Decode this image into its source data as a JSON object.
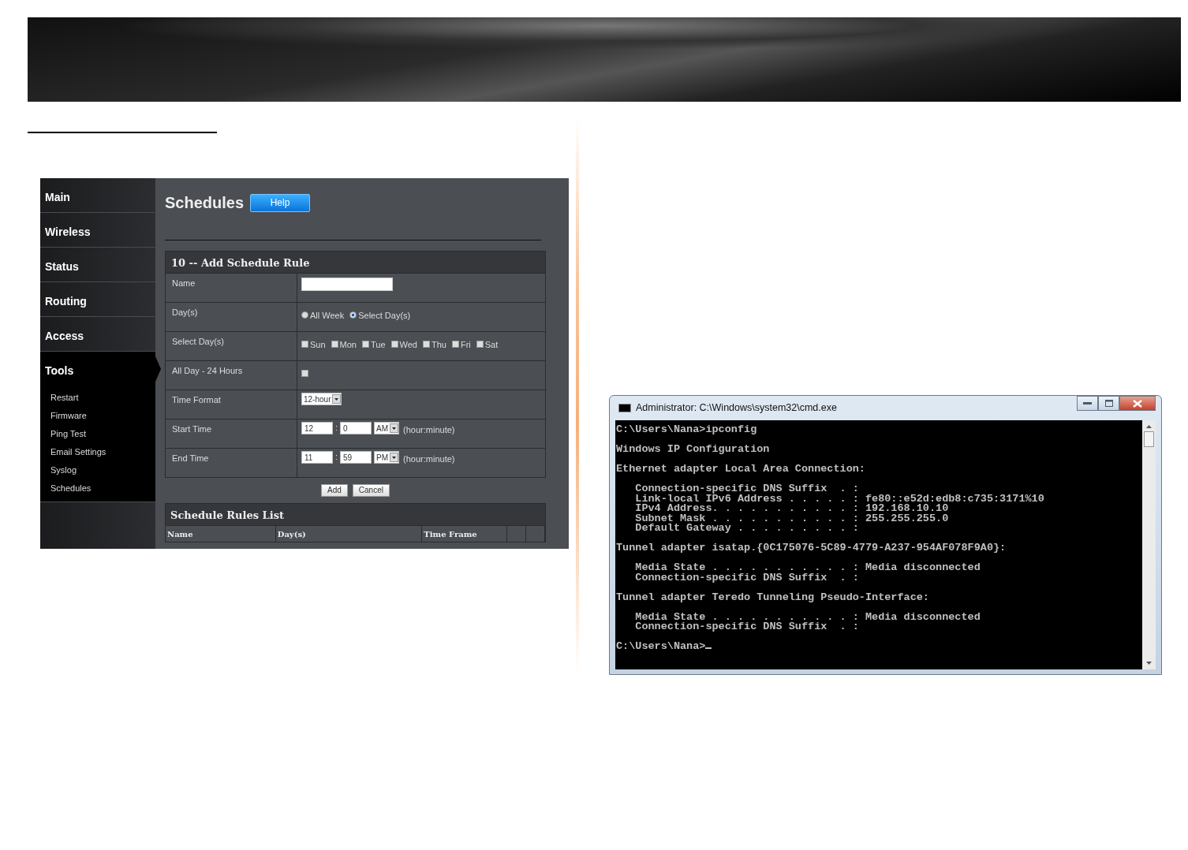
{
  "router_screenshot": {
    "sidebar": {
      "items": [
        {
          "label": "Main",
          "selected": false
        },
        {
          "label": "Wireless",
          "selected": false
        },
        {
          "label": "Status",
          "selected": false
        },
        {
          "label": "Routing",
          "selected": false
        },
        {
          "label": "Access",
          "selected": false
        },
        {
          "label": "Tools",
          "selected": true,
          "children": [
            {
              "label": "Restart"
            },
            {
              "label": "Firmware"
            },
            {
              "label": "Ping Test"
            },
            {
              "label": "Email Settings"
            },
            {
              "label": "Syslog"
            },
            {
              "label": "Schedules"
            }
          ]
        }
      ]
    },
    "page_title": "Schedules",
    "help_button": "Help",
    "form": {
      "title": "10 -- Add Schedule Rule",
      "rows": [
        {
          "kind": "text",
          "label": "Name"
        },
        {
          "kind": "radio",
          "label": "Day(s)",
          "options": [
            {
              "label": "All Week",
              "selected": false
            },
            {
              "label": "Select Day(s)",
              "selected": true
            }
          ]
        },
        {
          "kind": "checkboxes",
          "label": "Select Day(s)",
          "options": [
            {
              "label": "Sun",
              "checked": false
            },
            {
              "label": "Mon",
              "checked": false
            },
            {
              "label": "Tue",
              "checked": false
            },
            {
              "label": "Wed",
              "checked": false
            },
            {
              "label": "Thu",
              "checked": false
            },
            {
              "label": "Fri",
              "checked": false
            },
            {
              "label": "Sat",
              "checked": false
            }
          ]
        },
        {
          "kind": "checkbox",
          "label": "All Day - 24 Hours",
          "checked": false
        },
        {
          "kind": "select",
          "label": "Time Format",
          "value": "12-hour"
        },
        {
          "kind": "time",
          "label": "Start Time",
          "hour": "12",
          "separator": ":",
          "minute": "0",
          "ampm": "AM",
          "hint": "(hour:minute)"
        },
        {
          "kind": "time",
          "label": "End Time",
          "hour": "11",
          "separator": ":",
          "minute": "59",
          "ampm": "PM",
          "hint": "(hour:minute)"
        }
      ],
      "buttons": [
        "Add",
        "Cancel"
      ]
    },
    "rules_list": {
      "title": "Schedule Rules List",
      "columns": [
        "Name",
        "Day(s)",
        "Time Frame"
      ]
    }
  },
  "cmd_window": {
    "title": "Administrator: C:\\Windows\\system32\\cmd.exe",
    "blocks": [
      {
        "lines": [
          "C:\\Users\\Nana>ipconfig"
        ]
      },
      {
        "lines": [
          "Windows IP Configuration"
        ]
      },
      {
        "lines": [
          "Ethernet adapter Local Area Connection:"
        ]
      },
      {
        "lines": [
          "   Connection-specific DNS Suffix  . :",
          "   Link-local IPv6 Address . . . . . : fe80::e52d:edb8:c735:3171%10",
          "   IPv4 Address. . . . . . . . . . . : 192.168.10.10",
          "   Subnet Mask . . . . . . . . . . . : 255.255.255.0",
          "   Default Gateway . . . . . . . . . :"
        ]
      },
      {
        "lines": [
          "Tunnel adapter isatap.{0C175076-5C89-4779-A237-954AF078F9A0}:"
        ]
      },
      {
        "lines": [
          "   Media State . . . . . . . . . . . : Media disconnected",
          "   Connection-specific DNS Suffix  . :"
        ]
      },
      {
        "lines": [
          "Tunnel adapter Teredo Tunneling Pseudo-Interface:"
        ]
      },
      {
        "lines": [
          "   Media State . . . . . . . . . . . : Media disconnected",
          "   Connection-specific DNS Suffix  . :"
        ]
      }
    ],
    "prompt": "C:\\Users\\Nana>"
  }
}
